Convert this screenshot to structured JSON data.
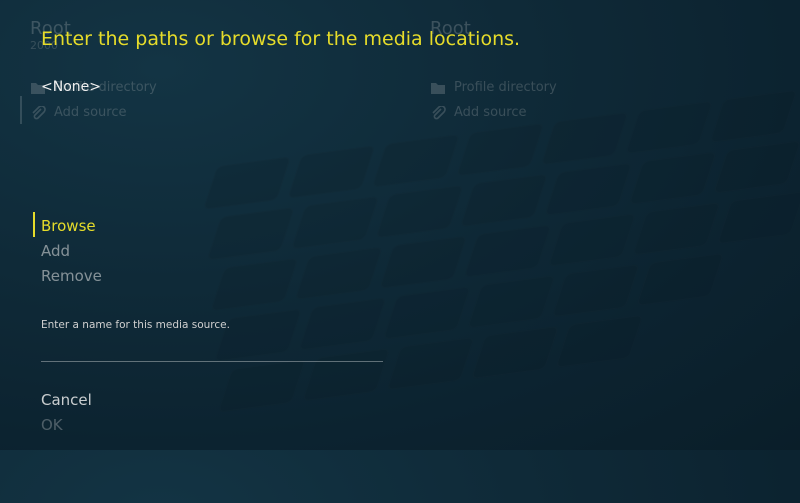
{
  "background": {
    "left_pane": {
      "title": "Root",
      "subtitle": "2000",
      "items": [
        {
          "label": "Profile directory",
          "icon": "folder-icon"
        },
        {
          "label": "Add source",
          "icon": "paperclip-icon"
        }
      ]
    },
    "right_pane": {
      "title": "Root",
      "items": [
        {
          "label": "Profile directory",
          "icon": "folder-icon"
        },
        {
          "label": "Add source",
          "icon": "paperclip-icon"
        }
      ]
    }
  },
  "dialog": {
    "heading": "Enter the paths or browse for the media locations.",
    "path_value": "<None>",
    "actions": {
      "browse": "Browse",
      "add": "Add",
      "remove": "Remove"
    },
    "name_label": "Enter a name for this media source.",
    "name_value": "",
    "cancel": "Cancel",
    "ok": "OK"
  },
  "colors": {
    "accent": "#e6dc2a",
    "background": "#0f2a38"
  }
}
